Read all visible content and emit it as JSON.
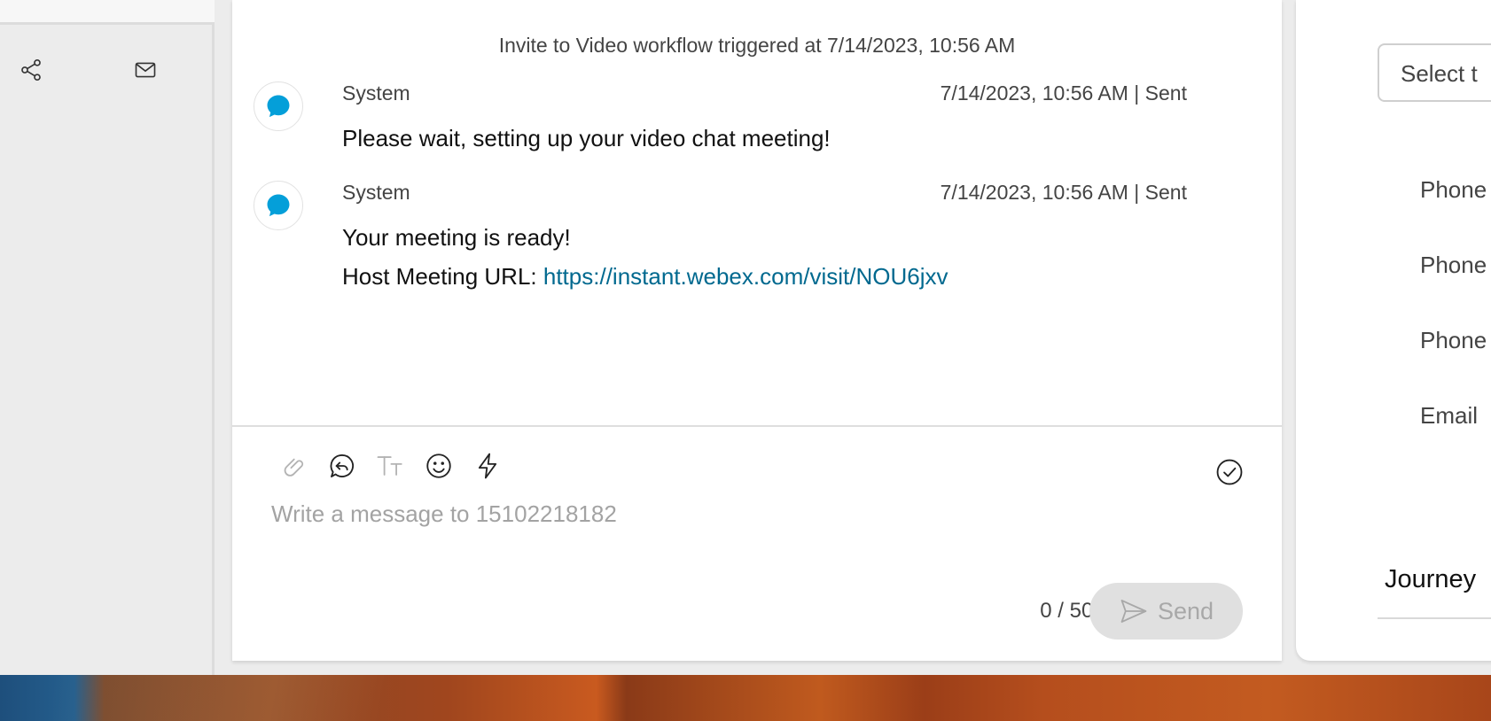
{
  "left_rail": {
    "icons": [
      "share-icon",
      "mail-icon"
    ]
  },
  "chat": {
    "workflow_note": "Invite to Video workflow triggered at 7/14/2023, 10:56 AM",
    "messages": [
      {
        "sender": "System",
        "meta": "7/14/2023, 10:56 AM | Sent",
        "line1": "Please wait, setting up your video chat meeting!"
      },
      {
        "sender": "System",
        "meta": "7/14/2023, 10:56 AM | Sent",
        "line1": "Your meeting is ready!",
        "line2_label": "Host Meeting URL: ",
        "line2_link": "https://instant.webex.com/visit/NOU6jxv"
      }
    ]
  },
  "composer": {
    "toolbar_icons": [
      "attachment-icon",
      "reply-icon",
      "text-format-icon",
      "emoji-icon",
      "quick-response-icon"
    ],
    "placeholder": "Write a message to 15102218182",
    "char_count": "0 / 5000",
    "send_label": "Send"
  },
  "right_panel": {
    "select_placeholder": "Select t",
    "field_labels": [
      "Phone",
      "Phone",
      "Phone",
      "Email"
    ],
    "journey_label": "Journey"
  },
  "colors": {
    "link": "#00698f",
    "webex_blue": "#049fd9",
    "send_disabled_bg": "#e0e0e0"
  }
}
